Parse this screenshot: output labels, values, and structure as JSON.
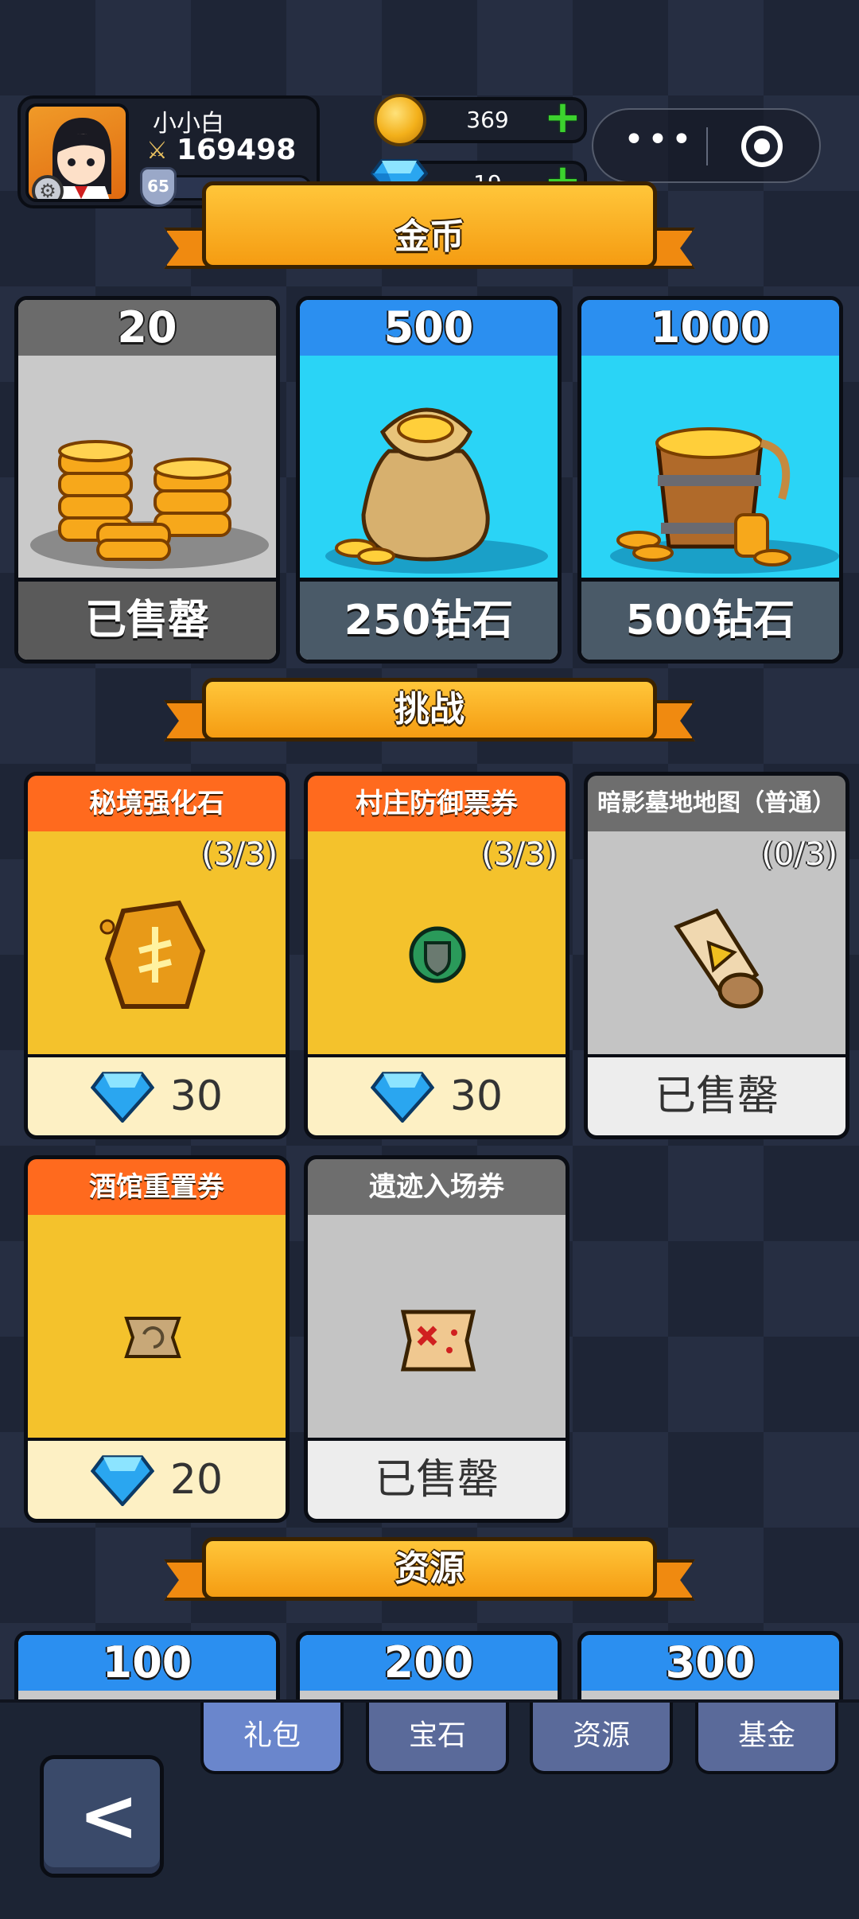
{
  "player": {
    "name": "小小白",
    "power": "169498",
    "level": "65",
    "level_status": "max"
  },
  "currency": {
    "gold": "369",
    "gems": "19"
  },
  "sections": {
    "gold": "金币",
    "challenge": "挑战",
    "resources": "资源"
  },
  "gold_packs": [
    {
      "amount": "20",
      "price": "已售罄",
      "state": "sold_out"
    },
    {
      "amount": "500",
      "price": "250钻石",
      "state": "available"
    },
    {
      "amount": "1000",
      "price": "500钻石",
      "state": "available"
    }
  ],
  "challenge_items": [
    {
      "name": "秘境强化石",
      "count": "(3/3)",
      "price": "30",
      "icon": "enhance-stone-icon"
    },
    {
      "name": "村庄防御票券",
      "count": "(3/3)",
      "price": "30",
      "icon": "defense-ticket-icon"
    },
    {
      "name": "暗影墓地地图（普通）",
      "count": "(0/3)",
      "price": "已售罄",
      "icon": "scroll-map-icon"
    },
    {
      "name": "酒馆重置券",
      "price": "20",
      "icon": "tavern-reset-ticket-icon"
    },
    {
      "name": "遗迹入场券",
      "price": "已售罄",
      "icon": "treasure-map-icon"
    }
  ],
  "resource_packs": [
    "100",
    "200",
    "300"
  ],
  "tabs": [
    "礼包",
    "宝石",
    "资源",
    "基金"
  ],
  "colors": {
    "accent_orange": "#f59c12",
    "gem_blue": "#2ad4f6",
    "sold_out_gray": "#5a5a5a"
  }
}
